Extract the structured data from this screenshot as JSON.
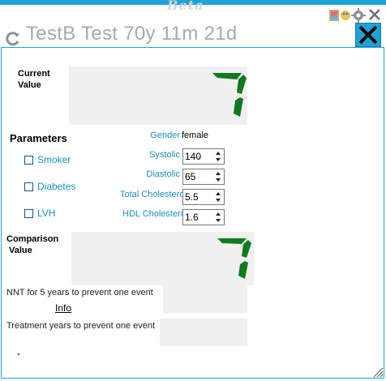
{
  "app": {
    "watermark": "Beta",
    "title": "TestB Test 70y 11m 21d"
  },
  "current_value": {
    "label_line1": "Current",
    "label_line2": "Value",
    "digit": "7"
  },
  "parameters": {
    "title": "Parameters",
    "checkboxes": [
      {
        "label": "Smoker",
        "checked": false
      },
      {
        "label": "Diabetes",
        "checked": false
      },
      {
        "label": "LVH",
        "checked": false
      }
    ],
    "gender": {
      "label": "Gender",
      "value": "female"
    },
    "inputs": [
      {
        "label": "Systolic",
        "value": "140"
      },
      {
        "label": "Diastolic",
        "value": "65"
      },
      {
        "label": "Total Cholesterol",
        "value": "5.5"
      },
      {
        "label": "HDL Cholesterol",
        "value": "1.6"
      }
    ]
  },
  "comparison_value": {
    "label_line1": "Comparison",
    "label_line2": "Value",
    "digit": "7"
  },
  "nnt": {
    "label": "NNT for 5 years to prevent one event",
    "info_link": "Info"
  },
  "treatment": {
    "label": "Treatment years to prevent one event"
  },
  "colors": {
    "accent": "#1fa3d6",
    "segment_green": "#0f7a1f",
    "title_gray": "#a3abb3",
    "label_blue": "#1a8ec4"
  }
}
